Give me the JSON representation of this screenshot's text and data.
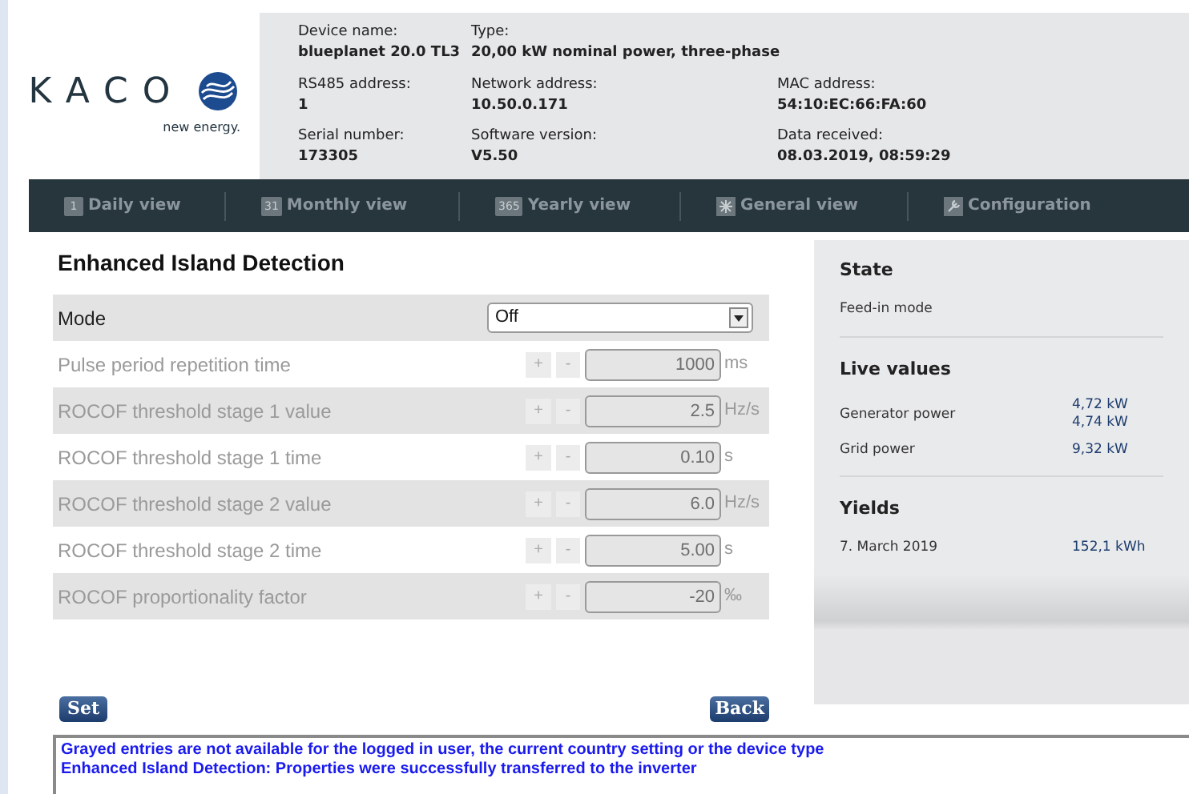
{
  "logo": {
    "wordmark": "KACO",
    "tagline": "new energy."
  },
  "device_info": [
    {
      "label": "Device name:",
      "value": "blueplanet 20.0 TL3"
    },
    {
      "label": "Type:",
      "value": "20,00 kW nominal power, three-phase"
    },
    {
      "label": "RS485 address:",
      "value": "1"
    },
    {
      "label": "Network address:",
      "value": "10.50.0.171"
    },
    {
      "label": "MAC address:",
      "value": "54:10:EC:66:FA:60"
    },
    {
      "label": "Serial number:",
      "value": "173305"
    },
    {
      "label": "Software version:",
      "value": "V5.50"
    },
    {
      "label": "Data received:",
      "value": "08.03.2019, 08:59:29"
    }
  ],
  "nav": [
    {
      "kind": "calendar",
      "label": "Daily view",
      "icon_text": "1",
      "selected": false
    },
    {
      "kind": "calendar",
      "label": "Monthly view",
      "icon_text": "31",
      "selected": false
    },
    {
      "kind": "calendar",
      "label": "Yearly view",
      "icon_text": "365",
      "selected": false
    },
    {
      "kind": "asterisk",
      "label": "General view",
      "selected": false
    },
    {
      "kind": "wrench",
      "label": "Configuration",
      "selected": false
    }
  ],
  "form": {
    "title": "Enhanced Island Detection",
    "rows": [
      {
        "kind": "select",
        "label": "Mode",
        "value": "Off",
        "disabled": false
      },
      {
        "kind": "number",
        "label": "Pulse period repetition time",
        "value": "1000",
        "unit": "ms",
        "disabled": true
      },
      {
        "kind": "number",
        "label": "ROCOF threshold stage 1 value",
        "value": "2.5",
        "unit": "Hz/s",
        "disabled": true
      },
      {
        "kind": "number",
        "label": "ROCOF threshold stage 1 time",
        "value": "0.10",
        "unit": "s",
        "disabled": true
      },
      {
        "kind": "number",
        "label": "ROCOF threshold stage 2 value",
        "value": "6.0",
        "unit": "Hz/s",
        "disabled": true
      },
      {
        "kind": "number",
        "label": "ROCOF threshold stage 2 time",
        "value": "5.00",
        "unit": "s",
        "disabled": true
      },
      {
        "kind": "number",
        "label": "ROCOF proportionality factor",
        "value": "-20",
        "unit": "‰",
        "disabled": true
      }
    ],
    "buttons": {
      "plus": "+",
      "minus": "-"
    },
    "set_button": "Set",
    "back_button": "Back"
  },
  "side_panel": [
    {
      "heading": "State",
      "items": [
        {
          "label": "Feed-in mode"
        }
      ]
    },
    {
      "heading": "Live values",
      "items": [
        {
          "label": "Generator power",
          "values": [
            "4,72 kW",
            "4,74 kW"
          ]
        },
        {
          "label": "Grid power",
          "values": [
            "9,32 kW"
          ]
        }
      ]
    },
    {
      "heading": "Yields",
      "items": [
        {
          "label": "7. March 2019",
          "values": [
            "152,1 kWh"
          ]
        }
      ]
    }
  ],
  "messages": [
    "Grayed entries are not available for the logged in user, the current country setting or the device type",
    "Enhanced Island Detection: Properties were successfully transferred to the inverter"
  ]
}
